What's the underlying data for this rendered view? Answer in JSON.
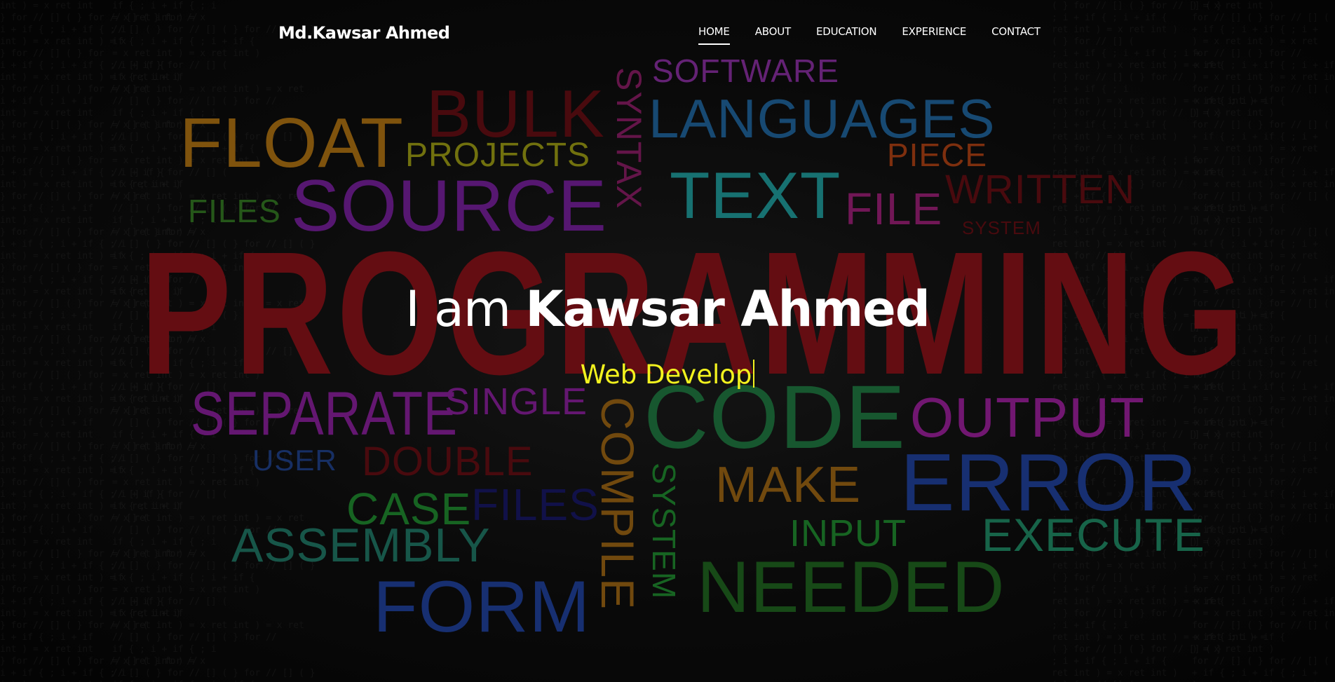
{
  "navbar": {
    "brand": "Md.Kawsar Ahmed",
    "items": [
      {
        "label": "HOME"
      },
      {
        "label": "ABOUT"
      },
      {
        "label": "EDUCATION"
      },
      {
        "label": "EXPERIENCE"
      },
      {
        "label": "CONTACT"
      }
    ],
    "active_item": "HOME"
  },
  "hero": {
    "greeting": "I am",
    "name": "Kawsar Ahmed",
    "typed_text": "Web Develop"
  },
  "word_cloud": {
    "main_word": "PROGRAMMING",
    "main_color": "#7a1016",
    "words": [
      {
        "text": "SOFTWARE",
        "color": "#7b2a8f"
      },
      {
        "text": "BULK",
        "color": "#5a0d12"
      },
      {
        "text": "FLOAT",
        "color": "#9c6611"
      },
      {
        "text": "PROJECTS",
        "color": "#8a8a12"
      },
      {
        "text": "SYNTAX",
        "color": "#7a1a5a"
      },
      {
        "text": "LANGUAGES",
        "color": "#1d5a8c"
      },
      {
        "text": "PIECE",
        "color": "#9a3a12"
      },
      {
        "text": "FILES",
        "color": "#2e6b1f"
      },
      {
        "text": "SOURCE",
        "color": "#6a1d8a"
      },
      {
        "text": "TEXT",
        "color": "#1d8a8a"
      },
      {
        "text": "FILE",
        "color": "#8a1d6a"
      },
      {
        "text": "WRITTEN",
        "color": "#5a0d12"
      },
      {
        "text": "SYSTEM",
        "color": "#5a0d12"
      },
      {
        "text": "SEPARATE",
        "color": "#7a1d8a"
      },
      {
        "text": "SINGLE",
        "color": "#7a1d8a"
      },
      {
        "text": "CODE",
        "color": "#1d6b3a"
      },
      {
        "text": "OUTPUT",
        "color": "#8a1d8a"
      },
      {
        "text": "USER",
        "color": "#1d3a7a"
      },
      {
        "text": "DOUBLE",
        "color": "#5a0d12"
      },
      {
        "text": "COMPILE",
        "color": "#8a5a12"
      },
      {
        "text": "SYSTEM",
        "color": "#1d7a2a"
      },
      {
        "text": "MAKE",
        "color": "#8a5a12"
      },
      {
        "text": "ERROR",
        "color": "#1d3a8a"
      },
      {
        "text": "CASE",
        "color": "#1d7a2a"
      },
      {
        "text": "FILES",
        "color": "#15155a"
      },
      {
        "text": "INPUT",
        "color": "#1d7a2a"
      },
      {
        "text": "EXECUTE",
        "color": "#1d7a5a"
      },
      {
        "text": "ASSEMBLY",
        "color": "#1d6a5a"
      },
      {
        "text": "NEEDED",
        "color": "#1d5a1d"
      },
      {
        "text": "FORM",
        "color": "#1d3a8a"
      }
    ]
  }
}
